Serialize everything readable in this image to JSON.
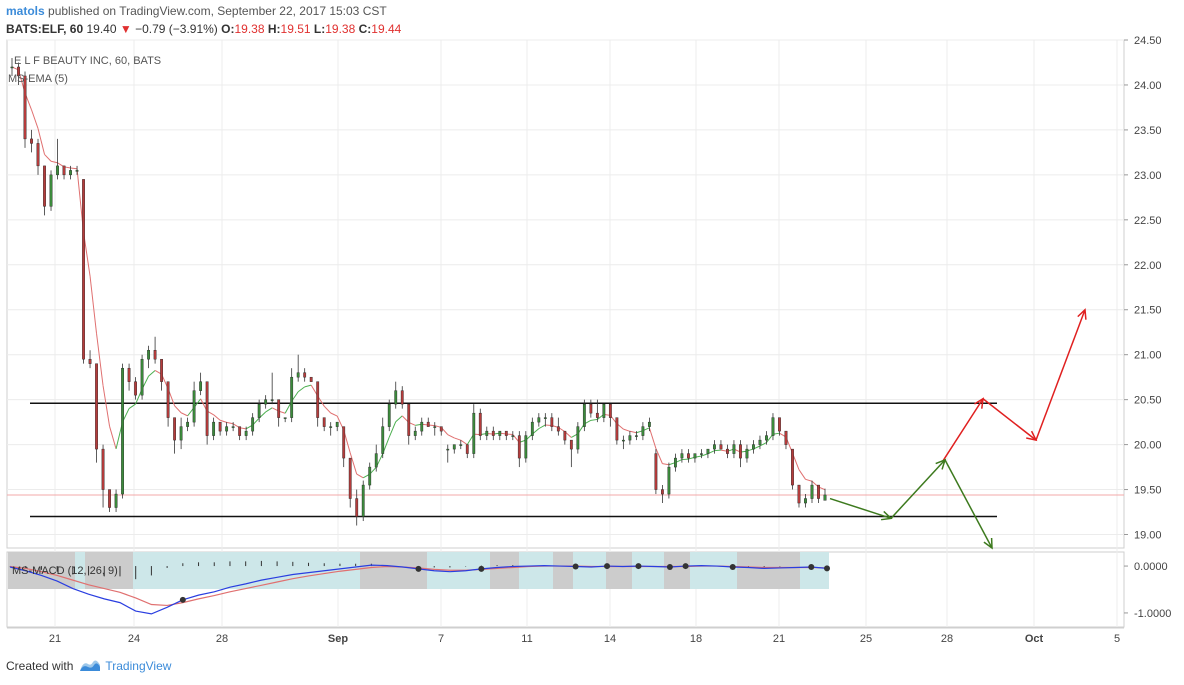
{
  "header": {
    "user": "matols",
    "published_text": "published on TradingView.com, September 22, 2017 15:03 CST",
    "symbol": "BATS:ELF, 60",
    "last": "19.40",
    "change": "−0.79 (−3.91%)",
    "ohlc": [
      {
        "label": "O:",
        "value": "19.38"
      },
      {
        "label": "H:",
        "value": "19.51"
      },
      {
        "label": "L:",
        "value": "19.38"
      },
      {
        "label": "C:",
        "value": "19.44"
      }
    ]
  },
  "footer": {
    "created_with": "Created with",
    "brand": "TradingView"
  },
  "colors": {
    "up": "#3c8b3c",
    "down": "#b53c3c",
    "ema_down": "#e07070",
    "ema_up": "#4caf50",
    "macd_blue": "#2a3ee0",
    "signal_red": "#e07070",
    "shade_gray": "#cccccc",
    "shade_cyan": "#cde7e9",
    "arrow_red": "#e02020",
    "arrow_green": "#3d7a1e",
    "grid": "#ececec",
    "axis_text": "#444444",
    "last_price_line": "#f3a8a8"
  },
  "chart_data": [
    {
      "type": "candlestick",
      "title": "E L F BEAUTY INC, 60, BATS",
      "indicator": "MS-EMA (5)",
      "x_ticks": [
        "21",
        "24",
        "28",
        "Sep",
        "7",
        "11",
        "14",
        "18",
        "21",
        "25",
        "28",
        "Oct",
        "5"
      ],
      "y_ticks": [
        "24.50",
        "24.00",
        "23.50",
        "23.00",
        "22.50",
        "22.00",
        "21.50",
        "21.00",
        "20.50",
        "20.00",
        "19.50",
        "19.00"
      ],
      "ylim": [
        18.85,
        24.5
      ],
      "last_price": 19.44,
      "candles": [
        [
          24.2,
          24.3,
          24.1,
          24.2
        ],
        [
          24.2,
          24.25,
          24.0,
          24.1
        ],
        [
          24.1,
          24.15,
          23.3,
          23.4
        ],
        [
          23.4,
          23.5,
          23.25,
          23.35
        ],
        [
          23.35,
          23.4,
          23.0,
          23.1
        ],
        [
          23.1,
          23.1,
          22.55,
          22.65
        ],
        [
          22.65,
          23.05,
          22.6,
          23.0
        ],
        [
          23.0,
          23.4,
          22.95,
          23.1
        ],
        [
          23.1,
          23.1,
          22.95,
          23.0
        ],
        [
          23.0,
          23.1,
          22.95,
          23.05
        ],
        [
          23.05,
          23.1,
          23.0,
          23.05
        ],
        [
          22.95,
          22.95,
          20.9,
          20.95
        ],
        [
          20.95,
          21.05,
          20.85,
          20.9
        ],
        [
          20.9,
          20.9,
          19.8,
          19.95
        ],
        [
          19.95,
          20.0,
          19.3,
          19.5
        ],
        [
          19.5,
          19.5,
          19.25,
          19.3
        ],
        [
          19.3,
          19.5,
          19.25,
          19.45
        ],
        [
          19.45,
          20.9,
          19.4,
          20.85
        ],
        [
          20.85,
          20.9,
          20.6,
          20.7
        ],
        [
          20.7,
          20.75,
          20.5,
          20.55
        ],
        [
          20.55,
          21.0,
          20.5,
          20.95
        ],
        [
          20.95,
          21.1,
          20.85,
          21.05
        ],
        [
          21.05,
          21.2,
          20.9,
          20.95
        ],
        [
          20.95,
          20.95,
          20.6,
          20.7
        ],
        [
          20.7,
          20.7,
          20.2,
          20.3
        ],
        [
          20.3,
          20.3,
          19.9,
          20.05
        ],
        [
          20.05,
          20.3,
          19.95,
          20.2
        ],
        [
          20.2,
          20.3,
          20.15,
          20.25
        ],
        [
          20.25,
          20.7,
          20.2,
          20.6
        ],
        [
          20.6,
          20.8,
          20.55,
          20.7
        ],
        [
          20.7,
          20.7,
          20.0,
          20.1
        ],
        [
          20.1,
          20.3,
          20.05,
          20.25
        ],
        [
          20.25,
          20.25,
          20.1,
          20.15
        ],
        [
          20.15,
          20.25,
          20.1,
          20.2
        ],
        [
          20.2,
          20.25,
          20.15,
          20.2
        ],
        [
          20.2,
          20.2,
          20.05,
          20.1
        ],
        [
          20.1,
          20.2,
          20.05,
          20.15
        ],
        [
          20.15,
          20.35,
          20.1,
          20.3
        ],
        [
          20.3,
          20.5,
          20.25,
          20.45
        ],
        [
          20.45,
          20.55,
          20.4,
          20.5
        ],
        [
          20.5,
          20.8,
          20.45,
          20.5
        ],
        [
          20.5,
          20.5,
          20.2,
          20.3
        ],
        [
          20.3,
          20.3,
          20.25,
          20.3
        ],
        [
          20.3,
          20.85,
          20.25,
          20.75
        ],
        [
          20.75,
          21.0,
          20.7,
          20.8
        ],
        [
          20.8,
          20.85,
          20.7,
          20.75
        ],
        [
          20.75,
          20.75,
          20.7,
          20.7
        ],
        [
          20.7,
          20.7,
          20.2,
          20.3
        ],
        [
          20.3,
          20.3,
          20.15,
          20.2
        ],
        [
          20.2,
          20.25,
          20.1,
          20.2
        ],
        [
          20.2,
          20.25,
          20.15,
          20.25
        ],
        [
          20.2,
          20.2,
          19.75,
          19.85
        ],
        [
          19.85,
          19.85,
          19.3,
          19.4
        ],
        [
          19.4,
          19.5,
          19.1,
          19.2
        ],
        [
          19.2,
          19.6,
          19.15,
          19.55
        ],
        [
          19.55,
          19.8,
          19.5,
          19.75
        ],
        [
          19.75,
          20.0,
          19.7,
          19.9
        ],
        [
          19.9,
          20.3,
          19.85,
          20.2
        ],
        [
          20.2,
          20.5,
          20.15,
          20.45
        ],
        [
          20.45,
          20.7,
          20.4,
          20.6
        ],
        [
          20.6,
          20.65,
          20.4,
          20.45
        ],
        [
          20.45,
          20.45,
          20.0,
          20.1
        ],
        [
          20.1,
          20.2,
          20.05,
          20.15
        ],
        [
          20.15,
          20.3,
          20.1,
          20.25
        ],
        [
          20.25,
          20.3,
          20.2,
          20.2
        ],
        [
          20.2,
          20.25,
          20.1,
          20.2
        ],
        [
          20.2,
          20.2,
          20.1,
          20.15
        ],
        [
          19.95,
          20.0,
          19.8,
          19.95
        ],
        [
          19.95,
          20.0,
          19.9,
          20.0
        ],
        [
          20.0,
          20.05,
          19.95,
          20.0
        ],
        [
          20.0,
          20.0,
          19.85,
          19.9
        ],
        [
          19.9,
          20.45,
          19.85,
          20.35
        ],
        [
          20.35,
          20.4,
          20.05,
          20.1
        ],
        [
          20.1,
          20.2,
          20.05,
          20.15
        ],
        [
          20.15,
          20.2,
          20.05,
          20.1
        ],
        [
          20.1,
          20.15,
          20.05,
          20.15
        ],
        [
          20.15,
          20.15,
          20.05,
          20.1
        ],
        [
          20.1,
          20.15,
          20.05,
          20.1
        ],
        [
          20.1,
          20.15,
          19.75,
          19.85
        ],
        [
          19.85,
          20.15,
          19.8,
          20.1
        ],
        [
          20.1,
          20.3,
          20.05,
          20.25
        ],
        [
          20.25,
          20.35,
          20.2,
          20.3
        ],
        [
          20.3,
          20.35,
          20.2,
          20.3
        ],
        [
          20.3,
          20.35,
          20.15,
          20.2
        ],
        [
          20.2,
          20.3,
          20.1,
          20.15
        ],
        [
          20.15,
          20.15,
          20.0,
          20.05
        ],
        [
          20.05,
          20.05,
          19.75,
          19.95
        ],
        [
          19.95,
          20.25,
          19.9,
          20.2
        ],
        [
          20.2,
          20.5,
          20.15,
          20.45
        ],
        [
          20.45,
          20.5,
          20.3,
          20.35
        ],
        [
          20.35,
          20.5,
          20.25,
          20.3
        ],
        [
          20.3,
          20.45,
          20.25,
          20.45
        ],
        [
          20.45,
          20.45,
          20.2,
          20.3
        ],
        [
          20.3,
          20.3,
          20.0,
          20.05
        ],
        [
          20.05,
          20.1,
          19.95,
          20.05
        ],
        [
          20.05,
          20.15,
          20.0,
          20.1
        ],
        [
          20.1,
          20.15,
          20.05,
          20.1
        ],
        [
          20.1,
          20.25,
          20.05,
          20.2
        ],
        [
          20.2,
          20.3,
          20.15,
          20.25
        ],
        [
          19.9,
          19.95,
          19.45,
          19.5
        ],
        [
          19.5,
          19.55,
          19.35,
          19.45
        ],
        [
          19.45,
          19.8,
          19.4,
          19.75
        ],
        [
          19.75,
          19.9,
          19.7,
          19.85
        ],
        [
          19.85,
          19.95,
          19.8,
          19.9
        ],
        [
          19.9,
          19.95,
          19.8,
          19.85
        ],
        [
          19.85,
          19.9,
          19.8,
          19.9
        ],
        [
          19.9,
          19.95,
          19.85,
          19.9
        ],
        [
          19.9,
          19.95,
          19.85,
          19.95
        ],
        [
          19.95,
          20.05,
          19.9,
          20.0
        ],
        [
          20.0,
          20.05,
          19.95,
          19.95
        ],
        [
          19.95,
          20.0,
          19.85,
          19.9
        ],
        [
          19.9,
          20.05,
          19.85,
          20.0
        ],
        [
          20.0,
          20.05,
          19.75,
          19.85
        ],
        [
          19.85,
          20.0,
          19.8,
          19.95
        ],
        [
          19.95,
          20.05,
          19.9,
          20.0
        ],
        [
          20.0,
          20.1,
          19.95,
          20.05
        ],
        [
          20.05,
          20.15,
          20.0,
          20.1
        ],
        [
          20.1,
          20.35,
          20.05,
          20.3
        ],
        [
          20.3,
          20.3,
          20.1,
          20.15
        ],
        [
          20.15,
          20.15,
          19.95,
          20.0
        ],
        [
          19.95,
          19.95,
          19.5,
          19.55
        ],
        [
          19.55,
          19.55,
          19.3,
          19.35
        ],
        [
          19.35,
          19.45,
          19.3,
          19.4
        ],
        [
          19.4,
          19.6,
          19.35,
          19.55
        ],
        [
          19.55,
          19.55,
          19.35,
          19.4
        ],
        [
          19.38,
          19.51,
          19.38,
          19.44
        ]
      ],
      "horizontal_lines": [
        20.46,
        19.2
      ],
      "projection_red": [
        [
          19.82,
          20.51
        ],
        [
          20.51,
          20.05
        ],
        [
          20.05,
          21.5
        ]
      ],
      "projection_green": [
        [
          19.4,
          19.18
        ],
        [
          19.18,
          19.83
        ],
        [
          19.83,
          18.85
        ]
      ]
    },
    {
      "type": "macd",
      "title": "MS-MACD (12, 26, 9)",
      "y_ticks": [
        "0.0000",
        "-1.0000"
      ],
      "ylim": [
        -1.3,
        0.3
      ],
      "macd": [
        -0.02,
        -0.1,
        -0.2,
        -0.32,
        -0.48,
        -0.6,
        -0.7,
        -0.78,
        -0.96,
        -1.02,
        -0.88,
        -0.72,
        -0.62,
        -0.55,
        -0.45,
        -0.38,
        -0.3,
        -0.24,
        -0.18,
        -0.14,
        -0.1,
        -0.06,
        -0.02,
        0.02,
        0.01,
        -0.02,
        -0.06,
        -0.1,
        -0.12,
        -0.1,
        -0.06,
        -0.03,
        -0.01,
        0.0,
        0.01,
        0.0,
        -0.01,
        -0.02,
        0.0,
        -0.01,
        0.0,
        -0.01,
        -0.02,
        0.0,
        0.01,
        0.0,
        -0.02,
        -0.03,
        -0.05,
        -0.04,
        -0.03,
        -0.02,
        -0.05
      ],
      "signal": [
        -0.01,
        -0.05,
        -0.12,
        -0.2,
        -0.3,
        -0.4,
        -0.48,
        -0.56,
        -0.68,
        -0.82,
        -0.84,
        -0.78,
        -0.7,
        -0.63,
        -0.55,
        -0.48,
        -0.41,
        -0.34,
        -0.27,
        -0.21,
        -0.16,
        -0.11,
        -0.07,
        -0.03,
        -0.01,
        -0.02,
        -0.04,
        -0.07,
        -0.09,
        -0.09,
        -0.07,
        -0.05,
        -0.03,
        -0.01,
        0.0,
        0.0,
        0.0,
        -0.01,
        -0.01,
        -0.01,
        -0.01,
        -0.01,
        -0.01,
        -0.01,
        0.0,
        0.0,
        -0.01,
        -0.02,
        -0.03,
        -0.03,
        -0.03,
        -0.03,
        -0.04
      ],
      "shading_pattern": [
        "gray",
        "cyan",
        "gray",
        "cyan",
        "gray",
        "cyan",
        "gray",
        "cyan",
        "gray",
        "cyan",
        "gray",
        "cyan",
        "gray",
        "cyan",
        "gray",
        "cyan",
        "gray"
      ]
    }
  ]
}
